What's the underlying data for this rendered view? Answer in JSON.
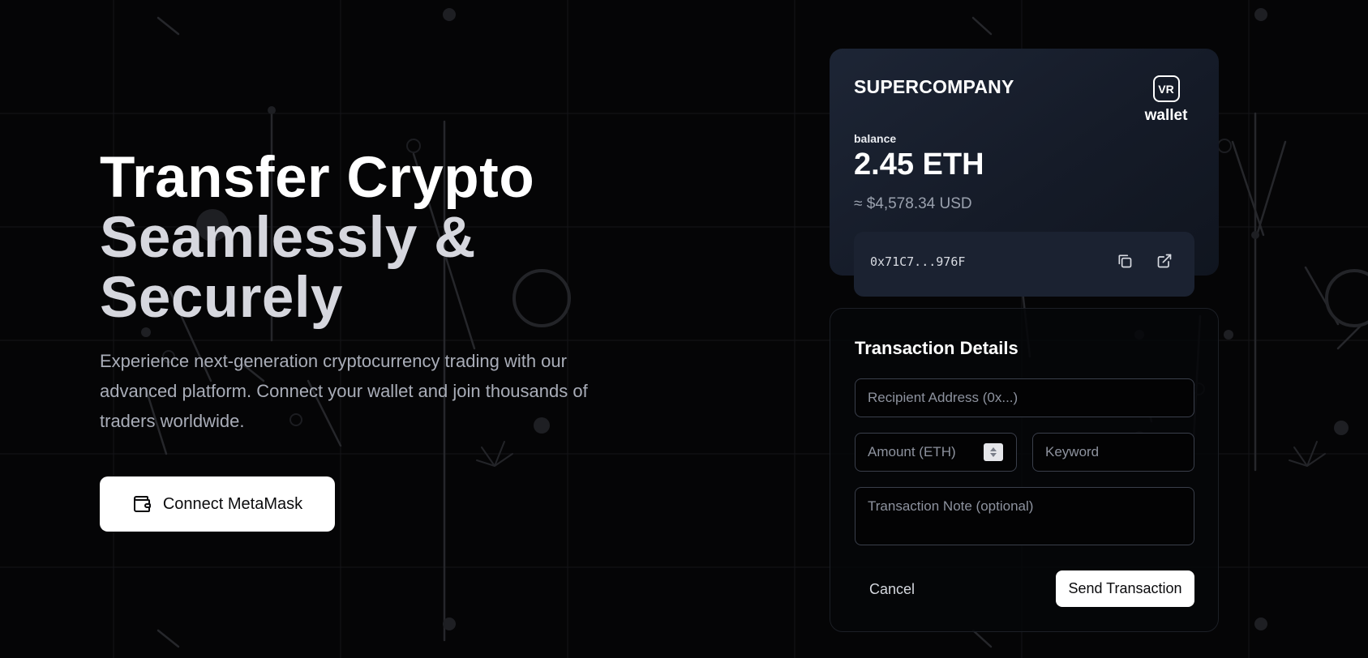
{
  "hero": {
    "title_line1": "Transfer Crypto",
    "title_line2": "Seamlessly &",
    "title_line3": "Securely",
    "description": "Experience next-generation cryptocurrency trading with our advanced platform. Connect your wallet and join thousands of traders worldwide.",
    "connect_label": "Connect MetaMask",
    "connect_icon": "wallet-icon"
  },
  "wallet_card": {
    "company": "SUPERCOMPANY",
    "logo_text": "VR",
    "logo_word": "wallet",
    "balance_label": "balance",
    "balance_value": "2.45 ETH",
    "balance_usd": "≈ $4,578.34 USD",
    "address": "0x71C7...976F",
    "copy_icon": "copy-icon",
    "external_icon": "external-link-icon"
  },
  "transaction": {
    "title": "Transaction Details",
    "recipient_placeholder": "Recipient Address (0x...)",
    "amount_placeholder": "Amount (ETH)",
    "keyword_placeholder": "Keyword",
    "note_placeholder": "Transaction Note (optional)",
    "cancel_label": "Cancel",
    "send_label": "Send Transaction"
  },
  "colors": {
    "background": "#050506",
    "card_bg": "#1a2130",
    "accent_white": "#ffffff",
    "muted_text": "#a9adb8"
  }
}
